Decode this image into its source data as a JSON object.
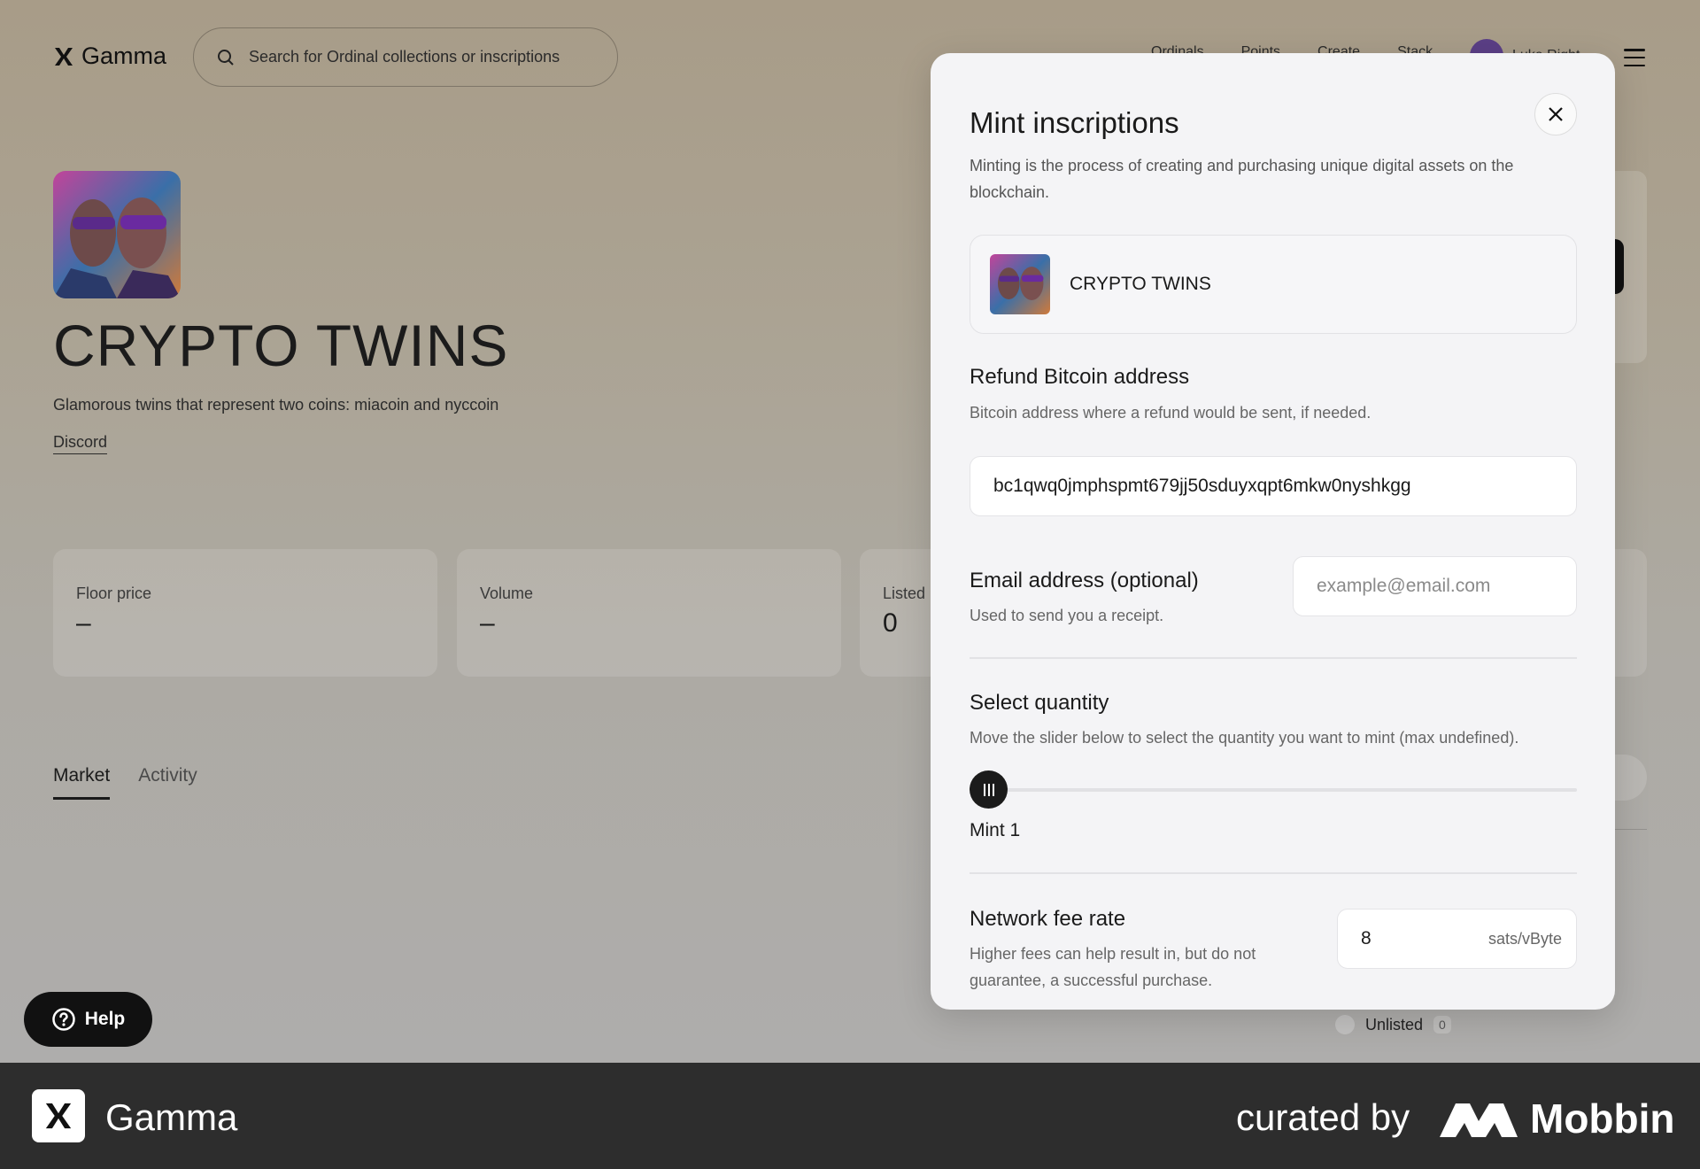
{
  "header": {
    "brand": "Gamma",
    "search_placeholder": "Search for Ordinal collections or inscriptions",
    "nav": [
      "Ordinals",
      "Points",
      "Create",
      "Stack"
    ],
    "profile_name": "Luke Right"
  },
  "collection": {
    "title": "CRYPTO TWINS",
    "description": "Glamorous twins that represent two coins: miacoin and nyccoin",
    "discord": "Discord"
  },
  "stats": [
    {
      "label": "Floor price",
      "value": "–"
    },
    {
      "label": "Volume",
      "value": "–"
    },
    {
      "label": "Listed",
      "value": "0"
    }
  ],
  "tabs": [
    "Market",
    "Activity"
  ],
  "filter": {
    "label": "Unlisted",
    "count": "0"
  },
  "help": {
    "label": "Help"
  },
  "modal": {
    "title": "Mint inscriptions",
    "subtitle": "Minting is the process of creating and purchasing unique digital assets on the blockchain.",
    "item_name": "CRYPTO TWINS",
    "refund": {
      "title": "Refund Bitcoin address",
      "subtitle": "Bitcoin address where a refund would be sent, if needed.",
      "value": "bc1qwq0jmphspmt679jj50sduyxqpt6mkw0nyshkgg"
    },
    "email": {
      "title": "Email address (optional)",
      "subtitle": "Used to send you a receipt.",
      "placeholder": "example@email.com"
    },
    "quantity": {
      "title": "Select quantity",
      "subtitle": "Move the slider below to select the quantity you want to mint (max undefined).",
      "mint_label": "Mint 1",
      "value": 1
    },
    "fee": {
      "title": "Network fee rate",
      "subtitle": "Higher fees can help result in, but do not guarantee, a successful purchase.",
      "value": "8",
      "unit": "sats/vByte"
    }
  },
  "footer": {
    "brand": "Gamma",
    "curated_by": "curated by",
    "mobbin": "Mobbin"
  }
}
